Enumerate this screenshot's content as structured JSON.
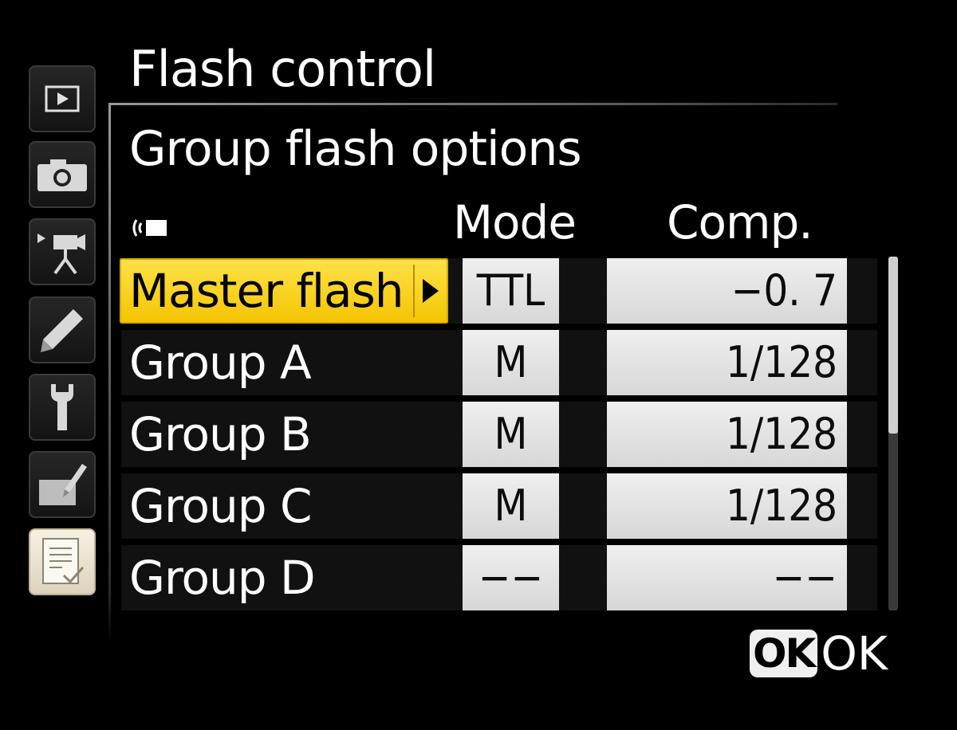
{
  "menu_title": "Flash control",
  "page_title": "Group flash options",
  "tabs": [
    {
      "icon": "playback-icon",
      "active": false
    },
    {
      "icon": "camera-icon",
      "active": false
    },
    {
      "icon": "movie-camera-icon",
      "active": false
    },
    {
      "icon": "pencil-icon",
      "active": false
    },
    {
      "icon": "wrench-icon",
      "active": false
    },
    {
      "icon": "retouch-icon",
      "active": false
    },
    {
      "icon": "recent-settings-icon",
      "active": true
    }
  ],
  "columns": {
    "mode": "Mode",
    "comp": "Comp."
  },
  "rows": [
    {
      "label": "Master flash",
      "mode": "TTL",
      "comp": "−0. 7",
      "selected": true
    },
    {
      "label": "Group A",
      "mode": "M",
      "comp": "1/128",
      "selected": false
    },
    {
      "label": "Group B",
      "mode": "M",
      "comp": "1/128",
      "selected": false
    },
    {
      "label": "Group C",
      "mode": "M",
      "comp": "1/128",
      "selected": false
    },
    {
      "label": "Group D",
      "mode": "−−",
      "comp": "−−",
      "selected": false
    }
  ],
  "ok_hint": {
    "badge": "OK",
    "label": "OK"
  },
  "colors": {
    "highlight": "#f3c400",
    "cell_bg": "#e4e4e4",
    "background": "#000000"
  }
}
